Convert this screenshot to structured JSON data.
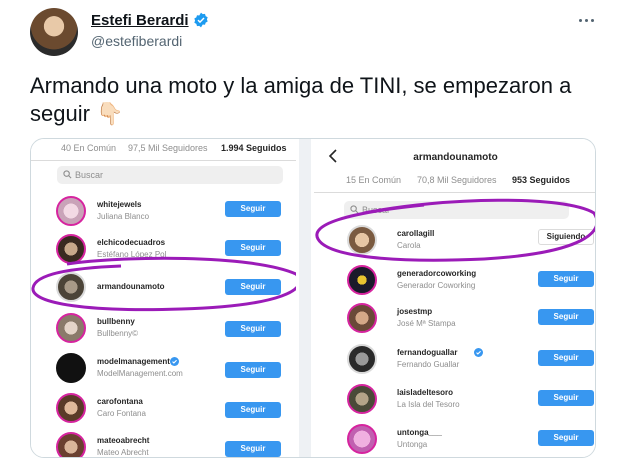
{
  "tweet": {
    "author_name": "Estefi Berardi",
    "author_handle": "@estefiberardi",
    "text": "Armando una moto y la amiga de TINI, se empezaron a seguir 👇🏻"
  },
  "left_panel": {
    "tabs": [
      "40 En Común",
      "97,5 Mil Seguidores",
      "1.994 Seguidos"
    ],
    "search_placeholder": "Buscar",
    "rows": [
      {
        "username": "whitejewels",
        "fullname": "Juliana Blanco",
        "button": "Seguir"
      },
      {
        "username": "elchicodecuadros",
        "fullname": "Estéfano López Pol",
        "button": "Seguir"
      },
      {
        "username": "armandounamoto",
        "fullname": "",
        "button": "Seguir"
      },
      {
        "username": "bullbenny",
        "fullname": "Bullbenny©",
        "button": "Seguir"
      },
      {
        "username": "modelmanagement",
        "fullname": "ModelManagement.com",
        "button": "Seguir"
      },
      {
        "username": "carofontana",
        "fullname": "Caro Fontana",
        "button": "Seguir"
      },
      {
        "username": "mateoabrecht",
        "fullname": "Mateo Abrecht",
        "button": "Seguir"
      }
    ]
  },
  "right_panel": {
    "profile_title": "armandounamoto",
    "tabs": [
      "15 En Común",
      "70,8 Mil Seguidores",
      "953 Seguidos"
    ],
    "search_placeholder": "Buscar",
    "rows": [
      {
        "username": "carollagill",
        "fullname": "Carola",
        "button": "Siguiendo"
      },
      {
        "username": "generadorcoworking",
        "fullname": "Generador Coworking",
        "button": "Seguir"
      },
      {
        "username": "josestmp",
        "fullname": "José Mª Stampa",
        "button": "Seguir"
      },
      {
        "username": "fernandoguallar",
        "fullname": "Fernando Guallar",
        "button": "Seguir"
      },
      {
        "username": "laisladeltesoro",
        "fullname": "La Isla del Tesoro",
        "button": "Seguir"
      },
      {
        "username": "untonga___",
        "fullname": "Untonga",
        "button": "Seguir"
      }
    ]
  },
  "colors": {
    "twitter_blue": "#1d9bf0",
    "instagram_blue": "#3897f0",
    "annotation_purple": "#9b1bb8"
  }
}
